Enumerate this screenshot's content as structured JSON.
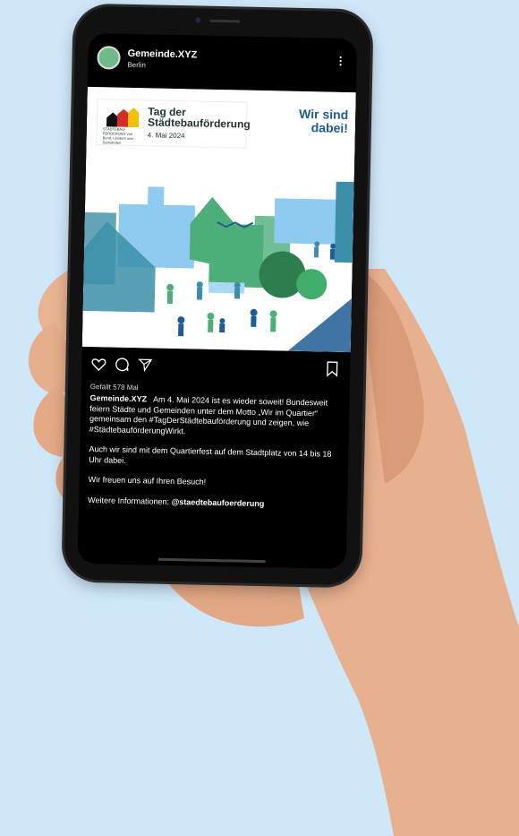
{
  "account": {
    "name": "Gemeinde.XYZ",
    "location": "Berlin",
    "more_icon": "more-vertical-icon"
  },
  "post_image": {
    "logo_title": "Tag der Städtebauförderung",
    "logo_date": "4. Mai 2024",
    "logo_small_text": "STÄDTEBAU- FÖRDERUNG von Bund, Ländern und Gemeinden",
    "tagline": "Wir sind dabei!",
    "colors": {
      "blue": "#1f5c95",
      "green": "#4caf7a",
      "teal": "#3b8fa8",
      "light_blue": "#8fcaf0"
    }
  },
  "actions": {
    "like_icon": "heart-icon",
    "comment_icon": "comment-icon",
    "share_icon": "send-icon",
    "save_icon": "bookmark-icon"
  },
  "likes": "Gefällt 578 Mal",
  "caption": {
    "author": "Gemeinde.XYZ",
    "p1": "Am 4. Mai 2024 ist es wieder soweit! Bundesweit feiern Städte und Gemeinden unter dem Motto „Wir im Quartier“ gemeinsam den #TagDerStädtebauförderung und zeigen, wie #StädtebauförderungWirkt.",
    "p2": "Auch wir sind mit dem Quartierfest auf dem Stadtplatz von 14 bis 18 Uhr dabei.",
    "p3": "Wir freuen uns auf Ihren Besuch!",
    "p4_prefix": "Weitere Informationen: ",
    "p4_handle": "@staedtebaufoerderung"
  }
}
